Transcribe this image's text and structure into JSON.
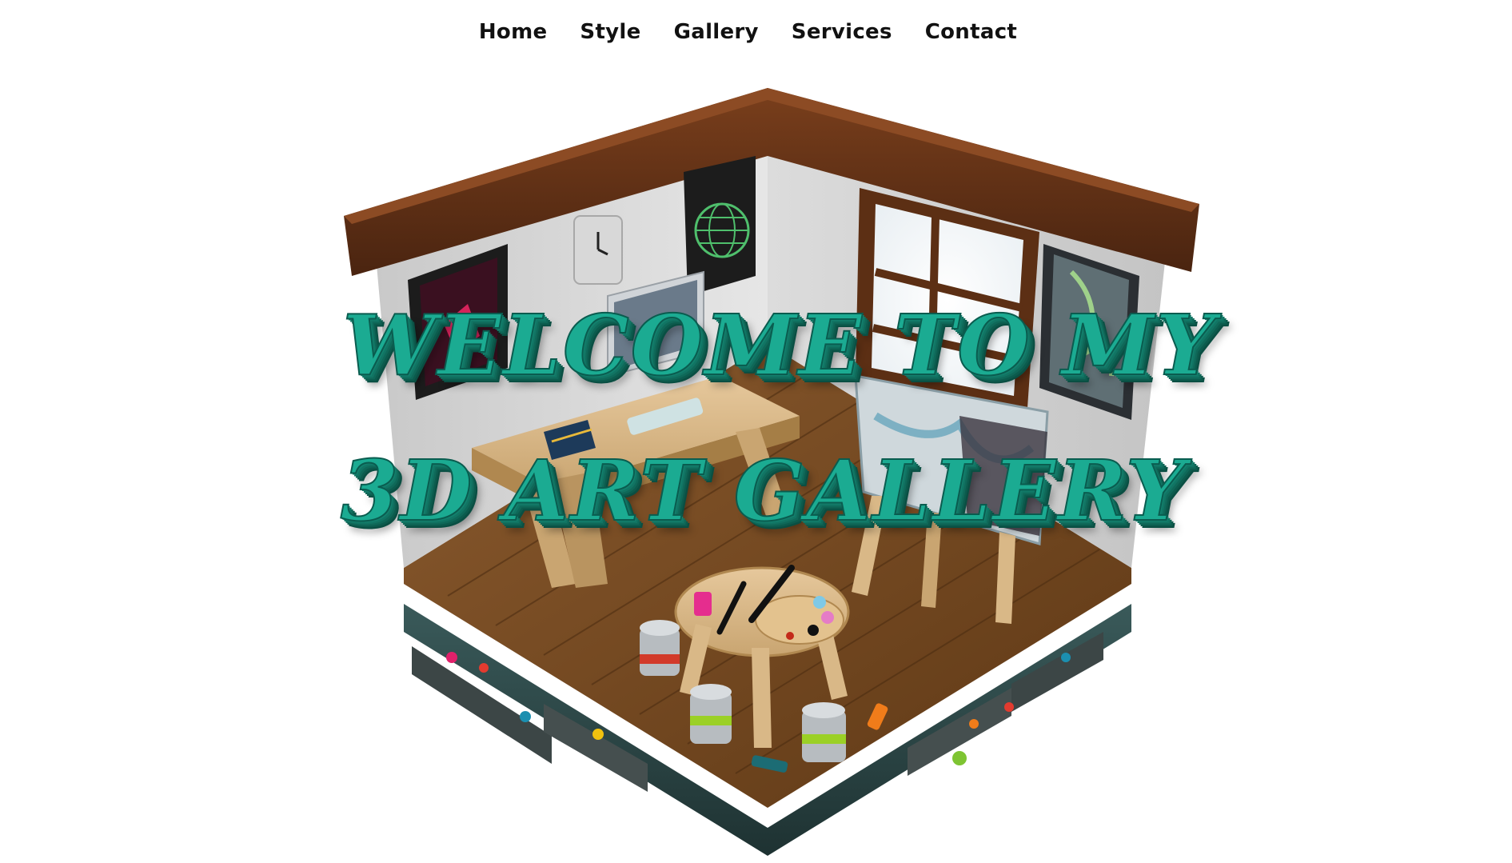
{
  "nav": {
    "items": [
      {
        "label": "Home"
      },
      {
        "label": "Style"
      },
      {
        "label": "Gallery"
      },
      {
        "label": "Services"
      },
      {
        "label": "Contact"
      }
    ]
  },
  "hero": {
    "title_line_1": "WELCOME TO MY",
    "title_line_2": "3D ART GALLERY",
    "title_color": "#1bab92"
  }
}
